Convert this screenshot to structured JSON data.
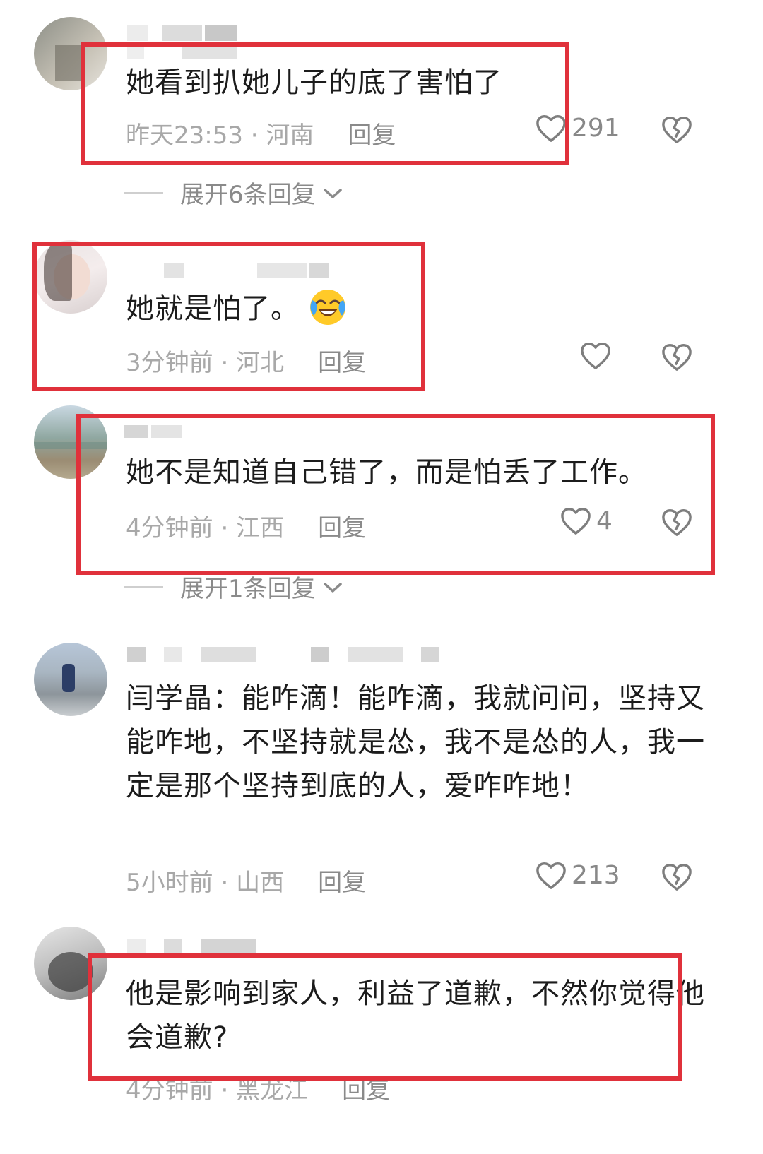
{
  "comments": [
    {
      "text": "她看到扒她儿子的底了害怕了",
      "time": "昨天23:53",
      "location": "河南",
      "reply_label": "回复",
      "like_count": "291",
      "expand_label": "展开6条回复"
    },
    {
      "text": "她就是怕了。",
      "time": "3分钟前",
      "location": "河北",
      "reply_label": "回复",
      "like_count": ""
    },
    {
      "text": "她不是知道自己错了，而是怕丢了工作。",
      "time": "4分钟前",
      "location": "江西",
      "reply_label": "回复",
      "like_count": "4",
      "expand_label": "展开1条回复"
    },
    {
      "text": "闫学晶：能咋滴！能咋滴，我就问问，坚持又能咋地，不坚持就是怂，我不是怂的人，我一定是那个坚持到底的人，爱咋咋地！",
      "time": "5小时前",
      "location": "山西",
      "reply_label": "回复",
      "like_count": "213"
    },
    {
      "text": "他是影响到家人，利益了道歉，不然你觉得他会道歉?",
      "time": "4分钟前",
      "location": "黑龙江",
      "reply_label": "回复",
      "like_count": ""
    }
  ],
  "separator": " · ",
  "colors": {
    "highlight_box": "#e0313b",
    "meta_text": "#a8a8a8",
    "body_text": "#1c1c1c"
  },
  "icons": {
    "like": "heart-outline-icon",
    "dislike": "broken-heart-icon",
    "expand": "chevron-down-icon",
    "emoji": "laughing-crying-emoji-icon"
  }
}
